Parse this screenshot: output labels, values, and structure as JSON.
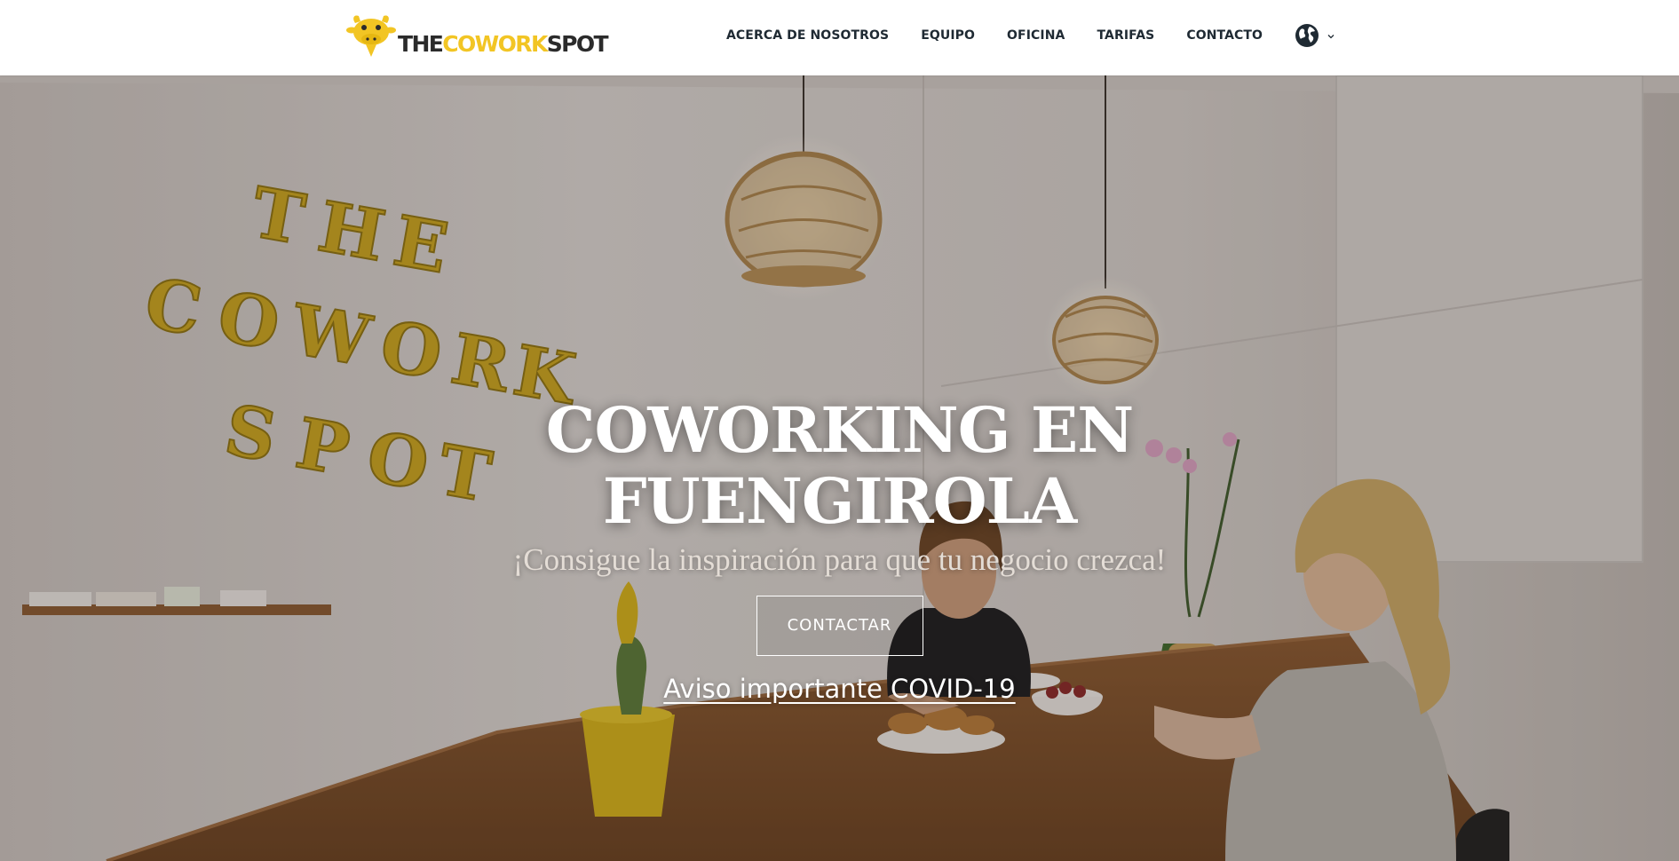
{
  "header": {
    "logo": {
      "part1": "THE",
      "part2": "COWORK",
      "part3": "SPOT"
    },
    "nav": [
      {
        "label": "ACERCA DE NOSOTROS"
      },
      {
        "label": "EQUIPO"
      },
      {
        "label": "OFICINA"
      },
      {
        "label": "TARIFAS"
      },
      {
        "label": "CONTACTO"
      }
    ],
    "language_icon": "globe-icon"
  },
  "hero": {
    "title_line1": "COWORKING EN",
    "title_line2": "FUENGIROLA",
    "subtitle": "¡Consigue la inspiración para que tu negocio crezca!",
    "cta_label": "CONTACTAR",
    "notice_link": "Aviso importante COVID-19",
    "wall_sign": [
      "THE",
      "COWORK",
      "SPOT"
    ]
  },
  "colors": {
    "brand_yellow": "#f2c524",
    "nav_text": "#1f2a33",
    "wall_letters": "#c9a520"
  }
}
